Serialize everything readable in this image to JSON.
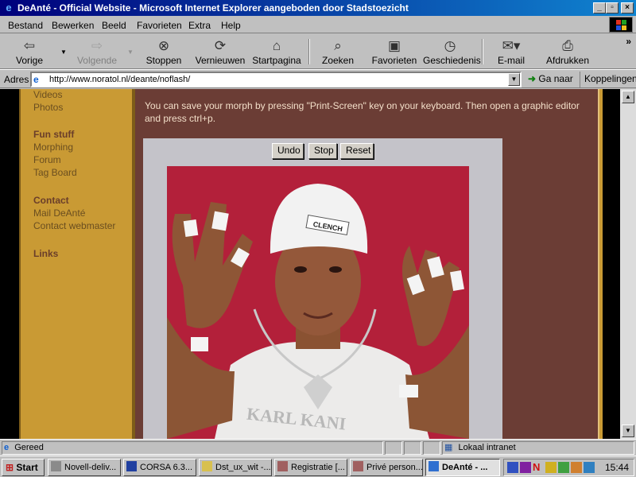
{
  "window": {
    "title": "DeAnté - Official Website - Microsoft Internet Explorer aangeboden door Stadstoezicht"
  },
  "menu": [
    "Bestand",
    "Bewerken",
    "Beeld",
    "Favorieten",
    "Extra",
    "Help"
  ],
  "toolbar": {
    "back": "Vorige",
    "forward": "Volgende",
    "stop": "Stoppen",
    "refresh": "Vernieuwen",
    "home": "Startpagina",
    "search": "Zoeken",
    "favorites": "Favorieten",
    "history": "Geschiedenis",
    "mail": "E-mail",
    "print": "Afdrukken"
  },
  "address": {
    "label": "Adres",
    "url": "http://www.noratol.nl/deante/noflash/",
    "go": "Ga naar",
    "links": "Koppelingen"
  },
  "sidebar": {
    "partial_items": [
      "Videos",
      "Photos"
    ],
    "sections": [
      {
        "heading": "Fun stuff",
        "items": [
          "Morphing",
          "Forum",
          "Tag Board"
        ]
      },
      {
        "heading": "Contact",
        "items": [
          "Mail DeAnté",
          "Contact webmaster"
        ]
      },
      {
        "heading": "Links",
        "items": []
      }
    ]
  },
  "main": {
    "instructions": "You can save your morph by pressing \"Print-Screen\" key on your keyboard. Then open a graphic editor and press ctrl+p.",
    "buttons": {
      "undo": "Undo",
      "stop": "Stop",
      "reset": "Reset"
    },
    "photo": {
      "shirt_text": "KARL KANI",
      "beanie_text": "CLENCH"
    }
  },
  "status": {
    "text": "Gereed",
    "zone": "Lokaal intranet"
  },
  "taskbar": {
    "start": "Start",
    "tasks": [
      {
        "label": "Novell-deliv...",
        "active": false
      },
      {
        "label": "CORSA  6.3...",
        "active": false
      },
      {
        "label": "Dst_ux_wit -...",
        "active": false
      },
      {
        "label": "Registratie [...",
        "active": false
      },
      {
        "label": "Privé person...",
        "active": false
      },
      {
        "label": "DeAnté - ...",
        "active": true
      }
    ],
    "clock": "15:44"
  }
}
